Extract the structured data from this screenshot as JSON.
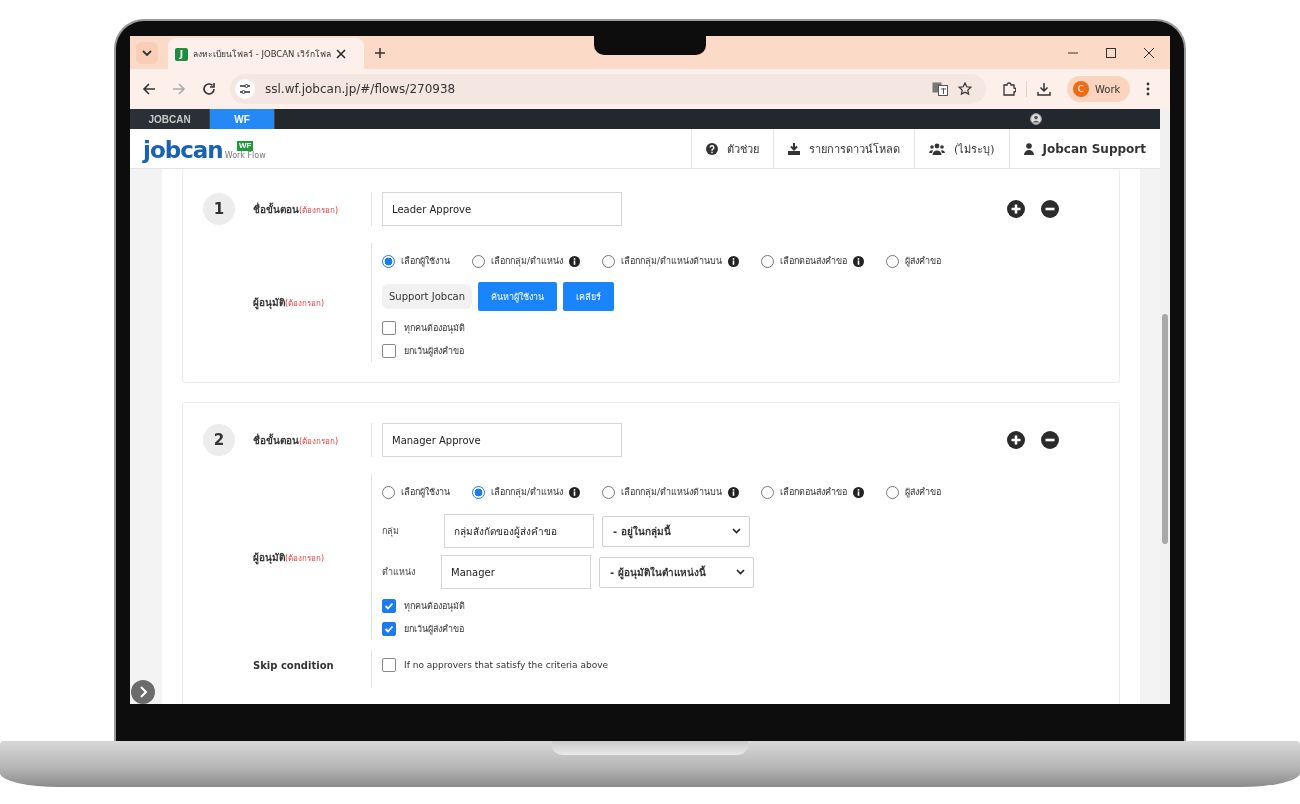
{
  "browser": {
    "favicon": "J",
    "tab_title": "ลงทะเบียนโฟลว์ - JOBCAN เวิร์กโฟล",
    "url": "ssl.wf.jobcan.jp/#/flows/270938",
    "profile_initial": "C",
    "profile_name": "Work"
  },
  "app_bar": [
    {
      "label": "JOBCAN",
      "selected": false
    },
    {
      "label": "WF",
      "selected": true
    }
  ],
  "logo": {
    "text": "jobcan",
    "badge": "WF",
    "subtext": "Work Flow"
  },
  "header_nav": [
    {
      "kind": "help",
      "label": "ตัวช่วย"
    },
    {
      "kind": "download",
      "label": "รายการดาวน์โหลด"
    },
    {
      "kind": "group",
      "label": "(ไม่ระบุ)"
    },
    {
      "kind": "user",
      "label": "Jobcan Support"
    }
  ],
  "steps": [
    {
      "number": "1",
      "name_label": "ชื่อขั้นตอน",
      "name_required": "(ต้องกรอก)",
      "name_value": "Leader Approve",
      "approver_label": "ผู้อนุมัติ",
      "approver_required": "(ต้องกรอก)",
      "options": [
        {
          "label": "เลือกผู้ใช้งาน",
          "info": false,
          "selected": true
        },
        {
          "label": "เลือกกลุ่ม/ตำแหน่ง",
          "info": true,
          "selected": false
        },
        {
          "label": "เลือกกลุ่ม/ตำแหน่งด้านบน",
          "info": true,
          "selected": false
        },
        {
          "label": "เลือกตอนส่งคำขอ",
          "info": true,
          "selected": false
        },
        {
          "label": "ผู้ส่งคำขอ",
          "info": false,
          "selected": false
        }
      ],
      "mode": {
        "kind": "user",
        "user": "Support Jobcan",
        "buttons": [
          "ค้นหาผู้ใช้งาน",
          "เคลียร์"
        ]
      },
      "checkboxes": [
        {
          "label": "ทุกคนต้องอนุมัติ",
          "checked": false
        },
        {
          "label": "ยกเว้นผู้ส่งคำขอ",
          "checked": false
        }
      ]
    },
    {
      "number": "2",
      "name_label": "ชื่อขั้นตอน",
      "name_required": "(ต้องกรอก)",
      "name_value": "Manager Approve",
      "approver_label": "ผู้อนุมัติ",
      "approver_required": "(ต้องกรอก)",
      "options": [
        {
          "label": "เลือกผู้ใช้งาน",
          "info": false,
          "selected": false
        },
        {
          "label": "เลือกกลุ่ม/ตำแหน่ง",
          "info": true,
          "selected": true
        },
        {
          "label": "เลือกกลุ่ม/ตำแหน่งด้านบน",
          "info": true,
          "selected": false
        },
        {
          "label": "เลือกตอนส่งคำขอ",
          "info": true,
          "selected": false
        },
        {
          "label": "ผู้ส่งคำขอ",
          "info": false,
          "selected": false
        }
      ],
      "mode": {
        "kind": "group",
        "rows": [
          {
            "label": "กลุ่ม",
            "value": "กลุ่มสังกัดของผู้ส่งคำขอ",
            "select": "- อยู่ในกลุ่มนี้"
          },
          {
            "label": "ตำแหน่ง",
            "value": "Manager",
            "select": "- ผู้อนุมัติในตำแหน่งนี้"
          }
        ]
      },
      "checkboxes": [
        {
          "label": "ทุกคนต้องอนุมัติ",
          "checked": true
        },
        {
          "label": "ยกเว้นผู้ส่งคำขอ",
          "checked": true
        }
      ],
      "skip": {
        "label": "Skip condition",
        "option": "If no approvers that satisfy the criteria above",
        "checked": false
      }
    }
  ]
}
